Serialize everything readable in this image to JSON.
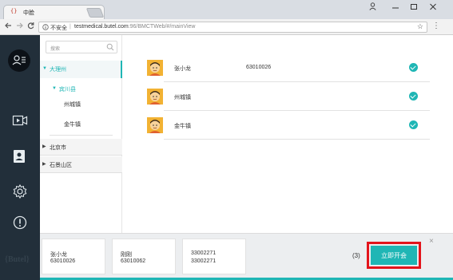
{
  "browser": {
    "tab_title": "中脸",
    "tab_favicon": "{}",
    "tab_close": "×",
    "security_label": "不安全",
    "separator": "|",
    "url_host": "testmedical.butel.com",
    "url_path": ":96/BMCTWeb/#/mainView",
    "icons": [
      "profile-icon",
      "minimize-icon",
      "maximize-icon",
      "close-icon",
      "back-icon",
      "forward-icon",
      "reload-icon",
      "info-icon",
      "star-icon",
      "menu-dots-icon"
    ]
  },
  "sidebar": {
    "brand": "{Butel}",
    "icons": [
      "contacts-icon",
      "video-icon",
      "user-card-icon",
      "settings-icon",
      "alert-icon"
    ]
  },
  "tree": {
    "search_placeholder": "搜索",
    "nodes": {
      "province": "大理州",
      "county": "宾川县",
      "town1": "州城镇",
      "town2": "金牛镇",
      "city": "北京市",
      "district": "石景山区"
    }
  },
  "members": [
    {
      "name": "张小龙",
      "id": "63010026",
      "checked": true
    },
    {
      "name": "州城镇",
      "id": "",
      "checked": true
    },
    {
      "name": "金牛镇",
      "id": "",
      "checked": true
    }
  ],
  "bottom": {
    "cards": [
      {
        "line1": "张小龙",
        "line2": "63010026"
      },
      {
        "line1": "刚刚",
        "line2": "63010062"
      },
      {
        "line1": "33002271",
        "line2": "33002271"
      }
    ],
    "count": "(3)",
    "start_button": "立即开会",
    "close": "×"
  },
  "colors": {
    "accent": "#1fb6b5",
    "sidebar": "#222f3a",
    "highlight": "#e3141b"
  }
}
